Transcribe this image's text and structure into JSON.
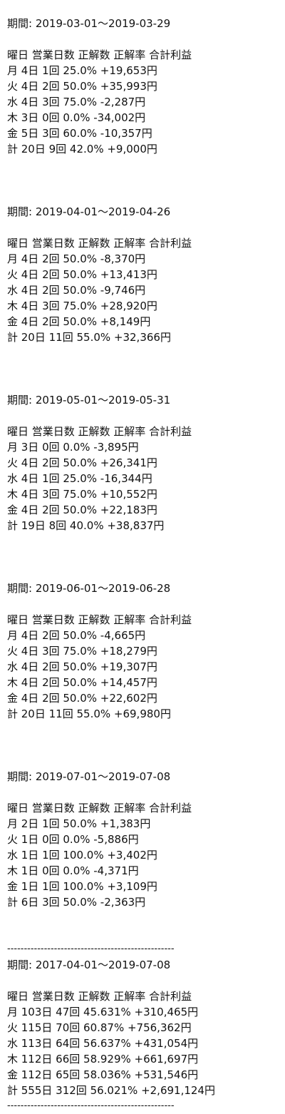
{
  "header_cols": "曜日 営業日数 正解数 正解率 合計利益",
  "periods": [
    {
      "label": "期間: 2019-03-01〜2019-03-29",
      "rows": [
        "月 4日 1回 25.0% +19,653円",
        "火 4日 2回 50.0% +35,993円",
        "水 4日 3回 75.0% -2,287円",
        "木 3日 0回 0.0% -34,002円",
        "金 5日 3回 60.0% -10,357円",
        "計 20日 9回 42.0% +9,000円"
      ]
    },
    {
      "label": "期間: 2019-04-01〜2019-04-26",
      "rows": [
        "月 4日 2回 50.0% -8,370円",
        "火 4日 2回 50.0% +13,413円",
        "水 4日 2回 50.0% -9,746円",
        "木 4日 3回 75.0% +28,920円",
        "金 4日 2回 50.0% +8,149円",
        "計 20日 11回 55.0% +32,366円"
      ]
    },
    {
      "label": "期間: 2019-05-01〜2019-05-31",
      "rows": [
        "月 3日 0回 0.0% -3,895円",
        "火 4日 2回 50.0% +26,341円",
        "水 4日 1回 25.0% -16,344円",
        "木 4日 3回 75.0% +10,552円",
        "金 4日 2回 50.0% +22,183円",
        "計 19日 8回 40.0% +38,837円"
      ]
    },
    {
      "label": "期間: 2019-06-01〜2019-06-28",
      "rows": [
        "月 4日 2回 50.0% -4,665円",
        "火 4日 3回 75.0% +18,279円",
        "水 4日 2回 50.0% +19,307円",
        "木 4日 2回 50.0% +14,457円",
        "金 4日 2回 50.0% +22,602円",
        "計 20日 11回 55.0% +69,980円"
      ]
    },
    {
      "label": "期間: 2019-07-01〜2019-07-08",
      "rows": [
        "月 2日 1回 50.0% +1,383円",
        "火 1日 0回 0.0% -5,886円",
        "水 1日 1回 100.0% +3,402円",
        "木 1日 0回 0.0% -4,371円",
        "金 1日 1回 100.0% +3,109円",
        "計 6日 3回 50.0% -2,363円"
      ]
    }
  ],
  "summary": {
    "divider": "--------------------------------------------------",
    "label": "期間: 2017-04-01〜2019-07-08",
    "rows": [
      "月 103日 47回 45.631% +310,465円",
      "火 115日 70回 60.87% +756,362円",
      "水 113日 64回 56.637% +431,054円",
      "木 112日 66回 58.929% +661,697円",
      "金 112日 65回 58.036% +531,546円",
      "計 555日 312回 56.021% +2,691,124円"
    ]
  }
}
